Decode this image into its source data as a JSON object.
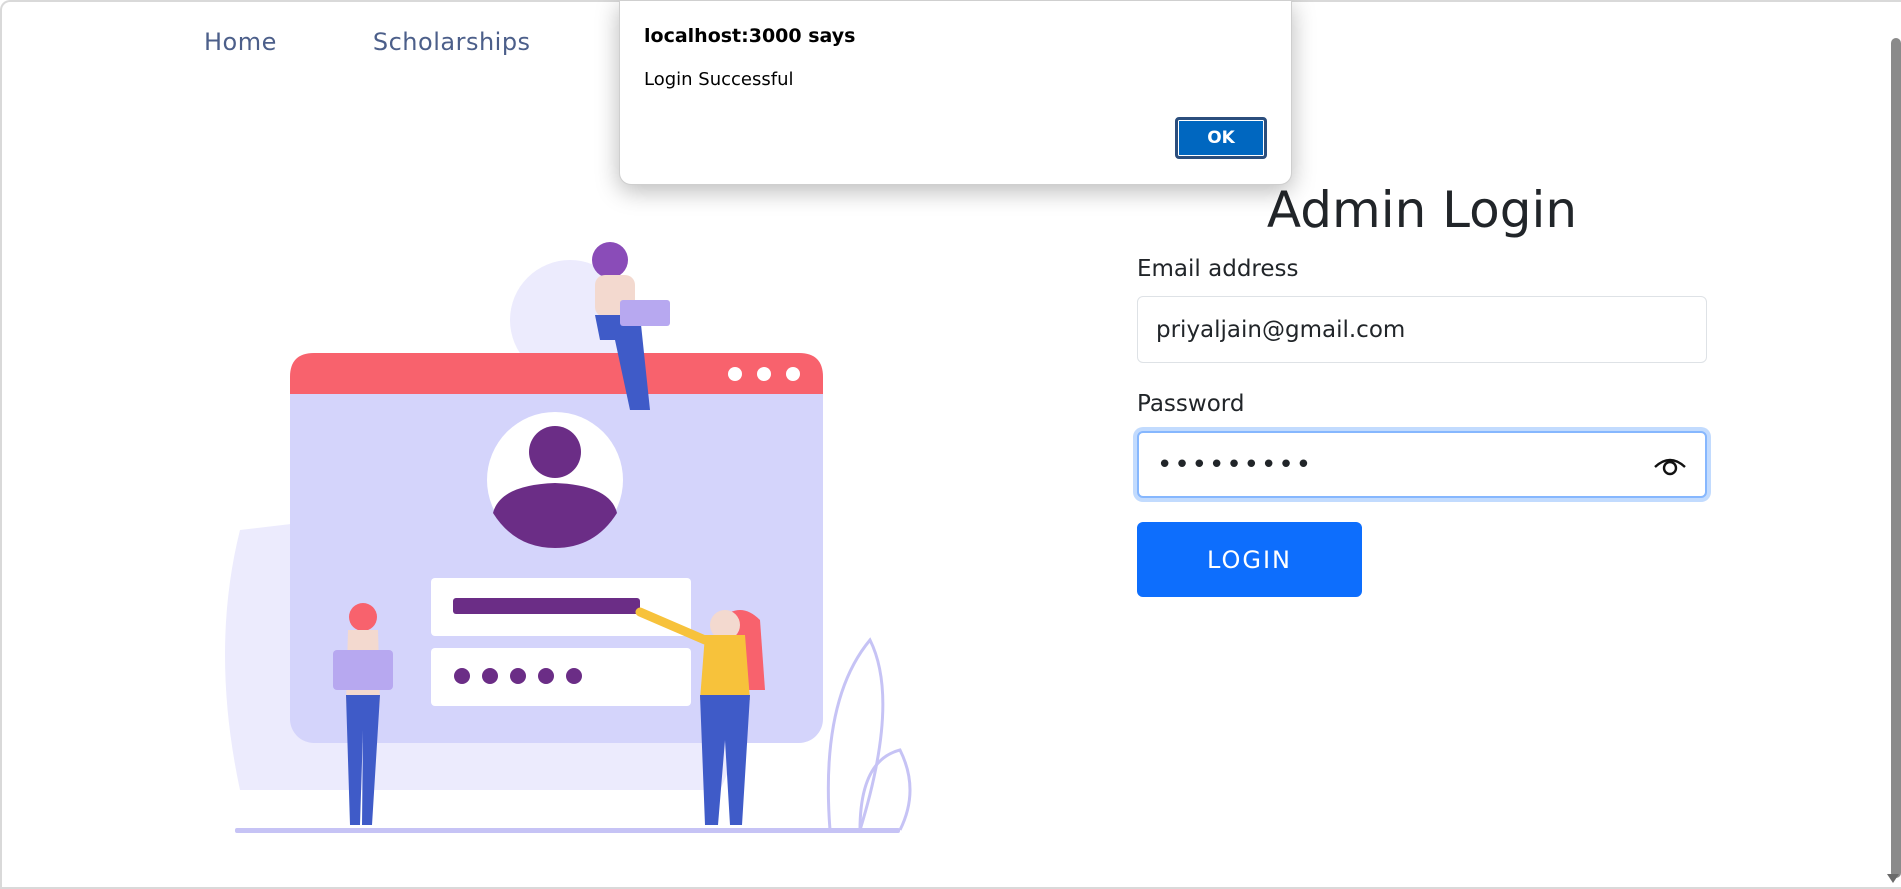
{
  "nav": {
    "items": [
      {
        "label": "Home"
      },
      {
        "label": "Scholarships"
      }
    ]
  },
  "dialog": {
    "title": "localhost:3000 says",
    "message": "Login Successful",
    "ok_label": "OK"
  },
  "login": {
    "heading": "Admin Login",
    "email_label": "Email address",
    "email_value": "priyaljain@gmail.com",
    "password_label": "Password",
    "password_masked": "•••••••••",
    "button_label": "LOGIN",
    "show_password_icon": "eye-icon"
  },
  "colors": {
    "primary": "#0d6efd",
    "nav_text": "#4c5f8a",
    "illustration_window_bar": "#f8626d",
    "illustration_window_body": "#d4d4fb",
    "illustration_avatar": "#6b2d86"
  }
}
